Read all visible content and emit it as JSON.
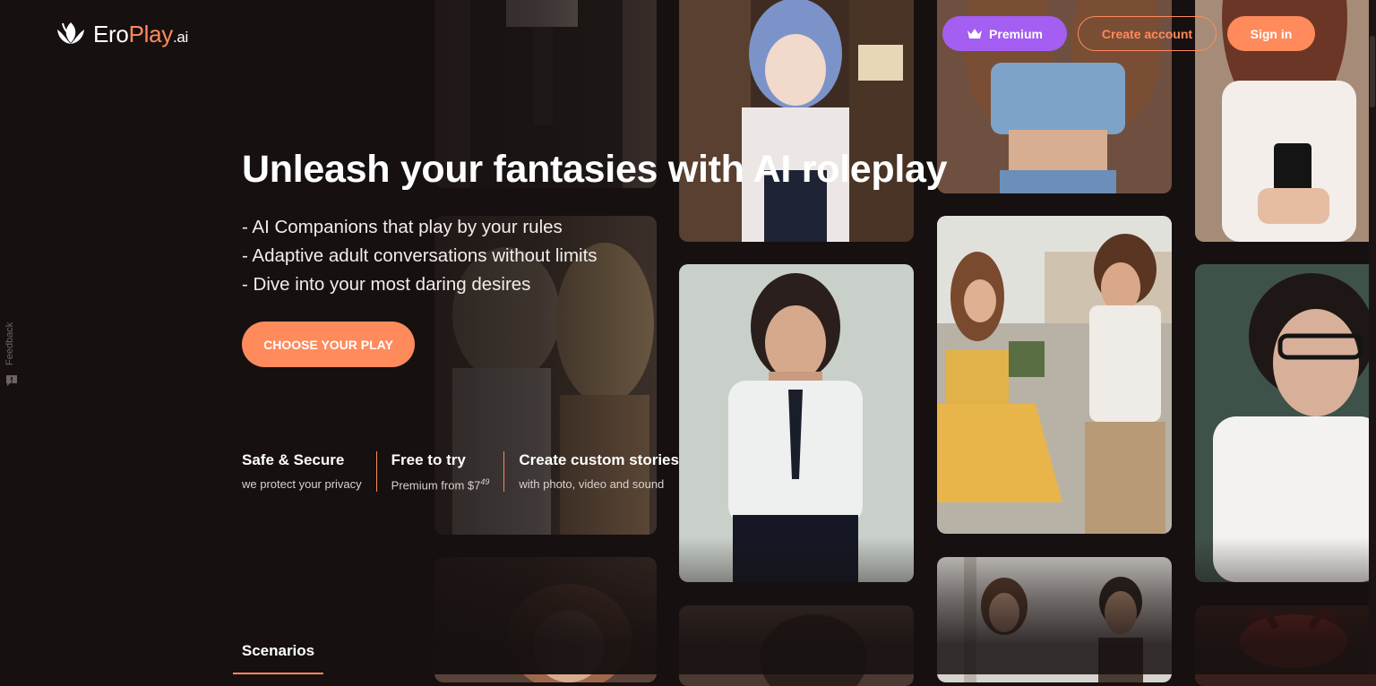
{
  "brand": {
    "logo_part1": "Ero",
    "logo_part2": "Play",
    "logo_part3": ".ai"
  },
  "header": {
    "premium_label": "Premium",
    "create_account_label": "Create account",
    "sign_in_label": "Sign in"
  },
  "hero": {
    "title": "Unleash your fantasies with AI roleplay",
    "features": [
      "- AI Companions that play by your rules",
      "- Adaptive adult conversations without limits",
      "- Dive into your most daring desires"
    ],
    "cta_label": "CHOOSE YOUR PLAY"
  },
  "stats": [
    {
      "title": "Safe & Secure",
      "subtitle": "we protect your privacy"
    },
    {
      "title": "Free to try",
      "subtitle_prefix": "Premium from $7",
      "subtitle_sup": "49"
    },
    {
      "title": "Create custom stories",
      "subtitle": "with photo, video and sound"
    }
  ],
  "tabs": {
    "active": "Scenarios"
  },
  "feedback": {
    "label": "Feedback"
  },
  "colors": {
    "background": "#161010",
    "accent": "#ff8a5c",
    "premium": "#a45ef2"
  }
}
